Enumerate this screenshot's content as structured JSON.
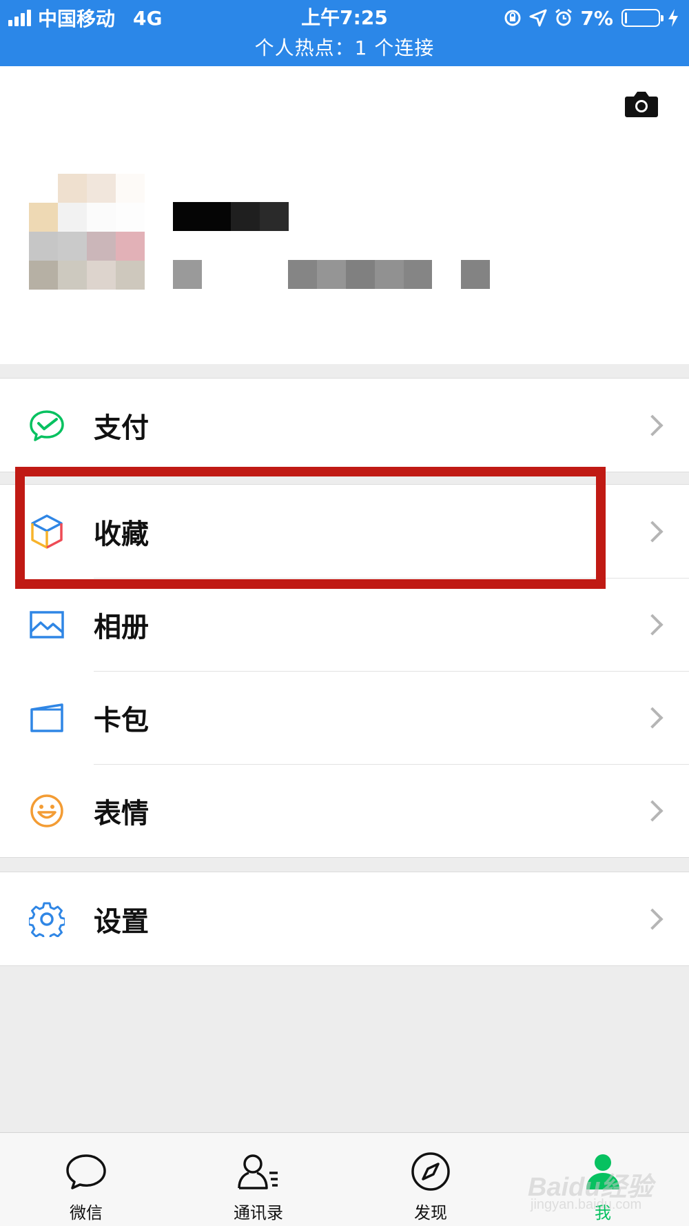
{
  "status_bar": {
    "carrier": "中国移动",
    "network": "4G",
    "time": "上午7:25",
    "battery_text": "7%",
    "battery_level": 0.07,
    "hotspot": "个人热点：1 个连接"
  },
  "profile": {
    "camera_icon": "camera-icon"
  },
  "menu_groups": [
    [
      {
        "label": "支付",
        "icon": "wallet-check-icon"
      }
    ],
    [
      {
        "label": "收藏",
        "icon": "favorites-cube-icon"
      },
      {
        "label": "相册",
        "icon": "album-image-icon"
      },
      {
        "label": "卡包",
        "icon": "card-wallet-icon"
      },
      {
        "label": "表情",
        "icon": "emoji-smile-icon"
      }
    ],
    [
      {
        "label": "设置",
        "icon": "gear-icon"
      }
    ]
  ],
  "tabs": [
    {
      "label": "微信",
      "icon": "chat-bubble-icon"
    },
    {
      "label": "通讯录",
      "icon": "contacts-icon"
    },
    {
      "label": "发现",
      "icon": "compass-icon"
    },
    {
      "label": "我",
      "icon": "me-person-icon",
      "active": true
    }
  ],
  "watermark": {
    "brand": "Baidu经验",
    "url": "jingyan.baidu.com"
  },
  "colors": {
    "status_bar": "#2b87e8",
    "highlight_box": "#c01a14",
    "active_tab": "#07c160",
    "pay_icon": "#07c160",
    "album_icon": "#2f86e5",
    "emoji_icon": "#f39c34",
    "settings_icon": "#2f86e5"
  }
}
